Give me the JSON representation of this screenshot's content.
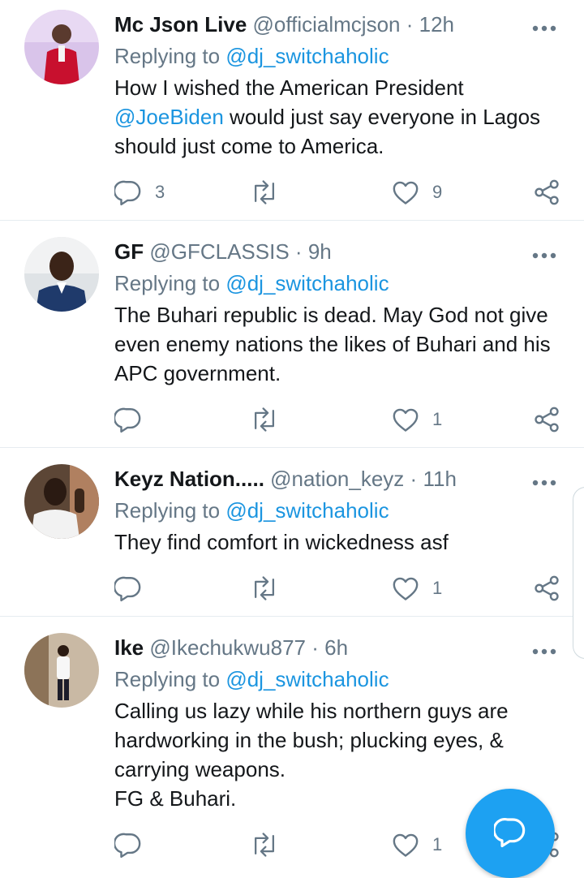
{
  "tweets": [
    {
      "name": "Mc Json Live",
      "handle": "@officialmcjson",
      "dot": "·",
      "time": "12h",
      "replying_prefix": "Replying to ",
      "replying_to": "@dj_switchaholic",
      "text_parts": [
        "How I wished the American President ",
        "@JoeBiden",
        " would just say everyone in Lagos should just come to America."
      ],
      "reply_count": "3",
      "retweet_count": "",
      "like_count": "9"
    },
    {
      "name": "GF",
      "handle": "@GFCLASSIS",
      "dot": "·",
      "time": "9h",
      "replying_prefix": "Replying to ",
      "replying_to": "@dj_switchaholic",
      "text": "The Buhari republic is dead. May God not give even enemy nations the likes of Buhari and his APC government.",
      "reply_count": "",
      "retweet_count": "",
      "like_count": "1"
    },
    {
      "name": "Keyz Nation.....",
      "handle": "@nation_keyz",
      "dot": "·",
      "time": "11h",
      "replying_prefix": "Replying to ",
      "replying_to": "@dj_switchaholic",
      "text": "They find comfort in wickedness asf",
      "reply_count": "",
      "retweet_count": "",
      "like_count": "1"
    },
    {
      "name": "Ike",
      "handle": "@Ikechukwu877",
      "dot": "·",
      "time": "6h",
      "replying_prefix": "Replying to ",
      "replying_to": "@dj_switchaholic",
      "text_lines": [
        "Calling us lazy while his northern guys are hardworking in the bush; plucking eyes, & carrying weapons.",
        "FG & Buhari."
      ],
      "reply_count": "",
      "retweet_count": "",
      "like_count": "1"
    }
  ],
  "icons": {
    "reply": "reply-icon",
    "retweet": "retweet-icon",
    "like": "heart-icon",
    "share": "share-icon",
    "more": "more-icon",
    "compose": "compose-reply-icon"
  },
  "colors": {
    "accent": "#1da1f2",
    "link": "#1b95e0",
    "secondary_text": "#657786",
    "primary_text": "#14171a"
  }
}
